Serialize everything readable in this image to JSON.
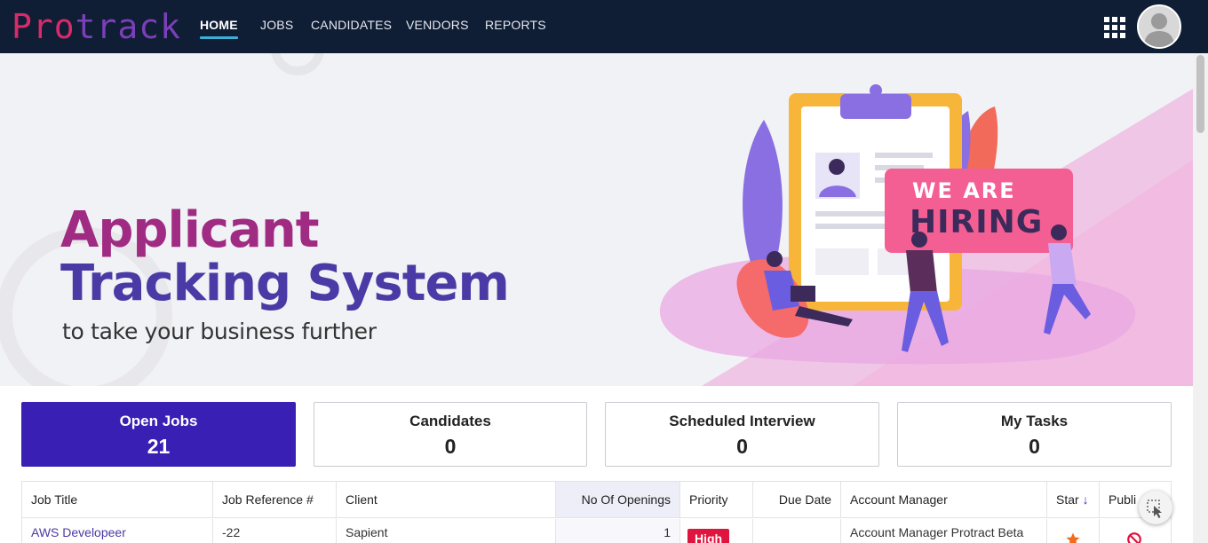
{
  "brand": {
    "logo_text_a": "Pro",
    "logo_text_b": "track"
  },
  "nav": {
    "items": [
      "HOME",
      "JOBS",
      "CANDIDATES",
      "VENDORS",
      "REPORTS"
    ],
    "active": "HOME"
  },
  "banner": {
    "title_line1": "Applicant",
    "title_line2": "Tracking System",
    "subtitle": "to take your business further",
    "sign_line1": "WE ARE",
    "sign_line2": "HIRING"
  },
  "stats": [
    {
      "label": "Open Jobs",
      "value": "21"
    },
    {
      "label": "Candidates",
      "value": "0"
    },
    {
      "label": "Scheduled Interview",
      "value": "0"
    },
    {
      "label": "My Tasks",
      "value": "0"
    }
  ],
  "table": {
    "columns": [
      "Job Title",
      "Job Reference #",
      "Client",
      "No Of Openings",
      "Priority",
      "Due Date",
      "Account Manager",
      "Star",
      "Publi"
    ],
    "rows": [
      {
        "job_title": "AWS Developeer",
        "job_reference": "-22",
        "client": "Sapient",
        "openings": "1",
        "priority": "High",
        "due_date": "",
        "account_manager": "Account Manager Protract Beta",
        "star": "star-icon",
        "publish": "not-published-icon"
      }
    ]
  },
  "colors": {
    "nav_bg": "#0f1d35",
    "accent": "#3a1fb5",
    "priority_high": "#e0153f",
    "star": "#f26b1d"
  }
}
